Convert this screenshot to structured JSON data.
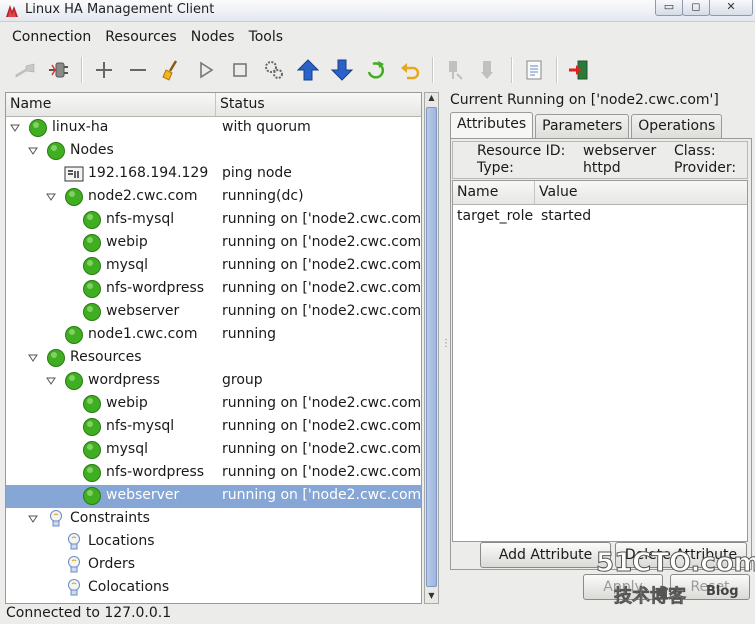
{
  "window": {
    "title": "Linux HA Management Client",
    "controls": {
      "minimize": "▭",
      "maximize": "◻",
      "close": "✕"
    }
  },
  "menu": [
    "Connection",
    "Resources",
    "Nodes",
    "Tools"
  ],
  "toolbar": {
    "icons": [
      "connect-icon",
      "disconnect-icon",
      "add-icon",
      "remove-icon",
      "cleanup-icon",
      "start-icon",
      "stop-icon",
      "settings-icon",
      "move-up-icon",
      "move-down-icon",
      "refresh-icon",
      "undo-icon",
      "standby-icon",
      "active-icon",
      "view-xml-icon",
      "exit-icon"
    ]
  },
  "tree": {
    "columns": {
      "name": "Name",
      "status": "Status"
    },
    "rows": [
      {
        "name": "linux-ha",
        "status": "with quorum",
        "level": 0,
        "expander": "expanded",
        "icon": "green"
      },
      {
        "name": "Nodes",
        "status": "",
        "level": 1,
        "expander": "expanded",
        "icon": "green"
      },
      {
        "name": "192.168.194.129",
        "status": "ping node",
        "level": 2,
        "expander": "none",
        "icon": "pingnode"
      },
      {
        "name": "node2.cwc.com",
        "status": "running(dc)",
        "level": 2,
        "expander": "expanded",
        "icon": "green"
      },
      {
        "name": "nfs-mysql",
        "status": "running on ['node2.cwc.com']",
        "level": 3,
        "expander": "none",
        "icon": "green"
      },
      {
        "name": "webip",
        "status": "running on ['node2.cwc.com']",
        "level": 3,
        "expander": "none",
        "icon": "green"
      },
      {
        "name": "mysql",
        "status": "running on ['node2.cwc.com']",
        "level": 3,
        "expander": "none",
        "icon": "green"
      },
      {
        "name": "nfs-wordpress",
        "status": "running on ['node2.cwc.com']",
        "level": 3,
        "expander": "none",
        "icon": "green"
      },
      {
        "name": "webserver",
        "status": "running on ['node2.cwc.com']",
        "level": 3,
        "expander": "none",
        "icon": "green"
      },
      {
        "name": "node1.cwc.com",
        "status": "running",
        "level": 2,
        "expander": "none",
        "icon": "green"
      },
      {
        "name": "Resources",
        "status": "",
        "level": 1,
        "expander": "expanded",
        "icon": "green"
      },
      {
        "name": "wordpress",
        "status": "group",
        "level": 2,
        "expander": "expanded",
        "icon": "green"
      },
      {
        "name": "webip",
        "status": "running on ['node2.cwc.com']",
        "level": 3,
        "expander": "none",
        "icon": "green"
      },
      {
        "name": "nfs-mysql",
        "status": "running on ['node2.cwc.com']",
        "level": 3,
        "expander": "none",
        "icon": "green"
      },
      {
        "name": "mysql",
        "status": "running on ['node2.cwc.com']",
        "level": 3,
        "expander": "none",
        "icon": "green"
      },
      {
        "name": "nfs-wordpress",
        "status": "running on ['node2.cwc.com']",
        "level": 3,
        "expander": "none",
        "icon": "green"
      },
      {
        "name": "webserver",
        "status": "running on ['node2.cwc.com']",
        "level": 3,
        "expander": "none",
        "icon": "green",
        "selected": true
      },
      {
        "name": "Constraints",
        "status": "",
        "level": 1,
        "expander": "expanded",
        "icon": "bulb"
      },
      {
        "name": "Locations",
        "status": "",
        "level": 2,
        "expander": "none",
        "icon": "bulb"
      },
      {
        "name": "Orders",
        "status": "",
        "level": 2,
        "expander": "none",
        "icon": "bulb"
      },
      {
        "name": "Colocations",
        "status": "",
        "level": 2,
        "expander": "none",
        "icon": "bulb"
      }
    ]
  },
  "detail": {
    "current_running": "Current Running on ['node2.cwc.com']",
    "tabs": [
      "Attributes",
      "Parameters",
      "Operations"
    ],
    "active_tab": "Attributes",
    "resource_info": {
      "id_label": "Resource ID:",
      "id_value": "webserver",
      "type_label": "Type:",
      "type_value": "httpd",
      "class_label": "Class:",
      "provider_label": "Provider:"
    },
    "attributes": {
      "columns": {
        "name": "Name",
        "value": "Value"
      },
      "rows": [
        {
          "name": "target_role",
          "value": "started"
        }
      ]
    },
    "buttons": {
      "add": "Add Attribute",
      "delete": "Delete Attribute",
      "apply": "Apply",
      "reset": "Reset"
    }
  },
  "statusbar": "Connected to 127.0.0.1",
  "watermark": {
    "main": "51CTO.com",
    "sub": "技术博客",
    "blog": "Blog"
  },
  "colors": {
    "node_green": "#3fae21",
    "selection": "#86a6d6",
    "accent_blue": "#2a62c9"
  }
}
